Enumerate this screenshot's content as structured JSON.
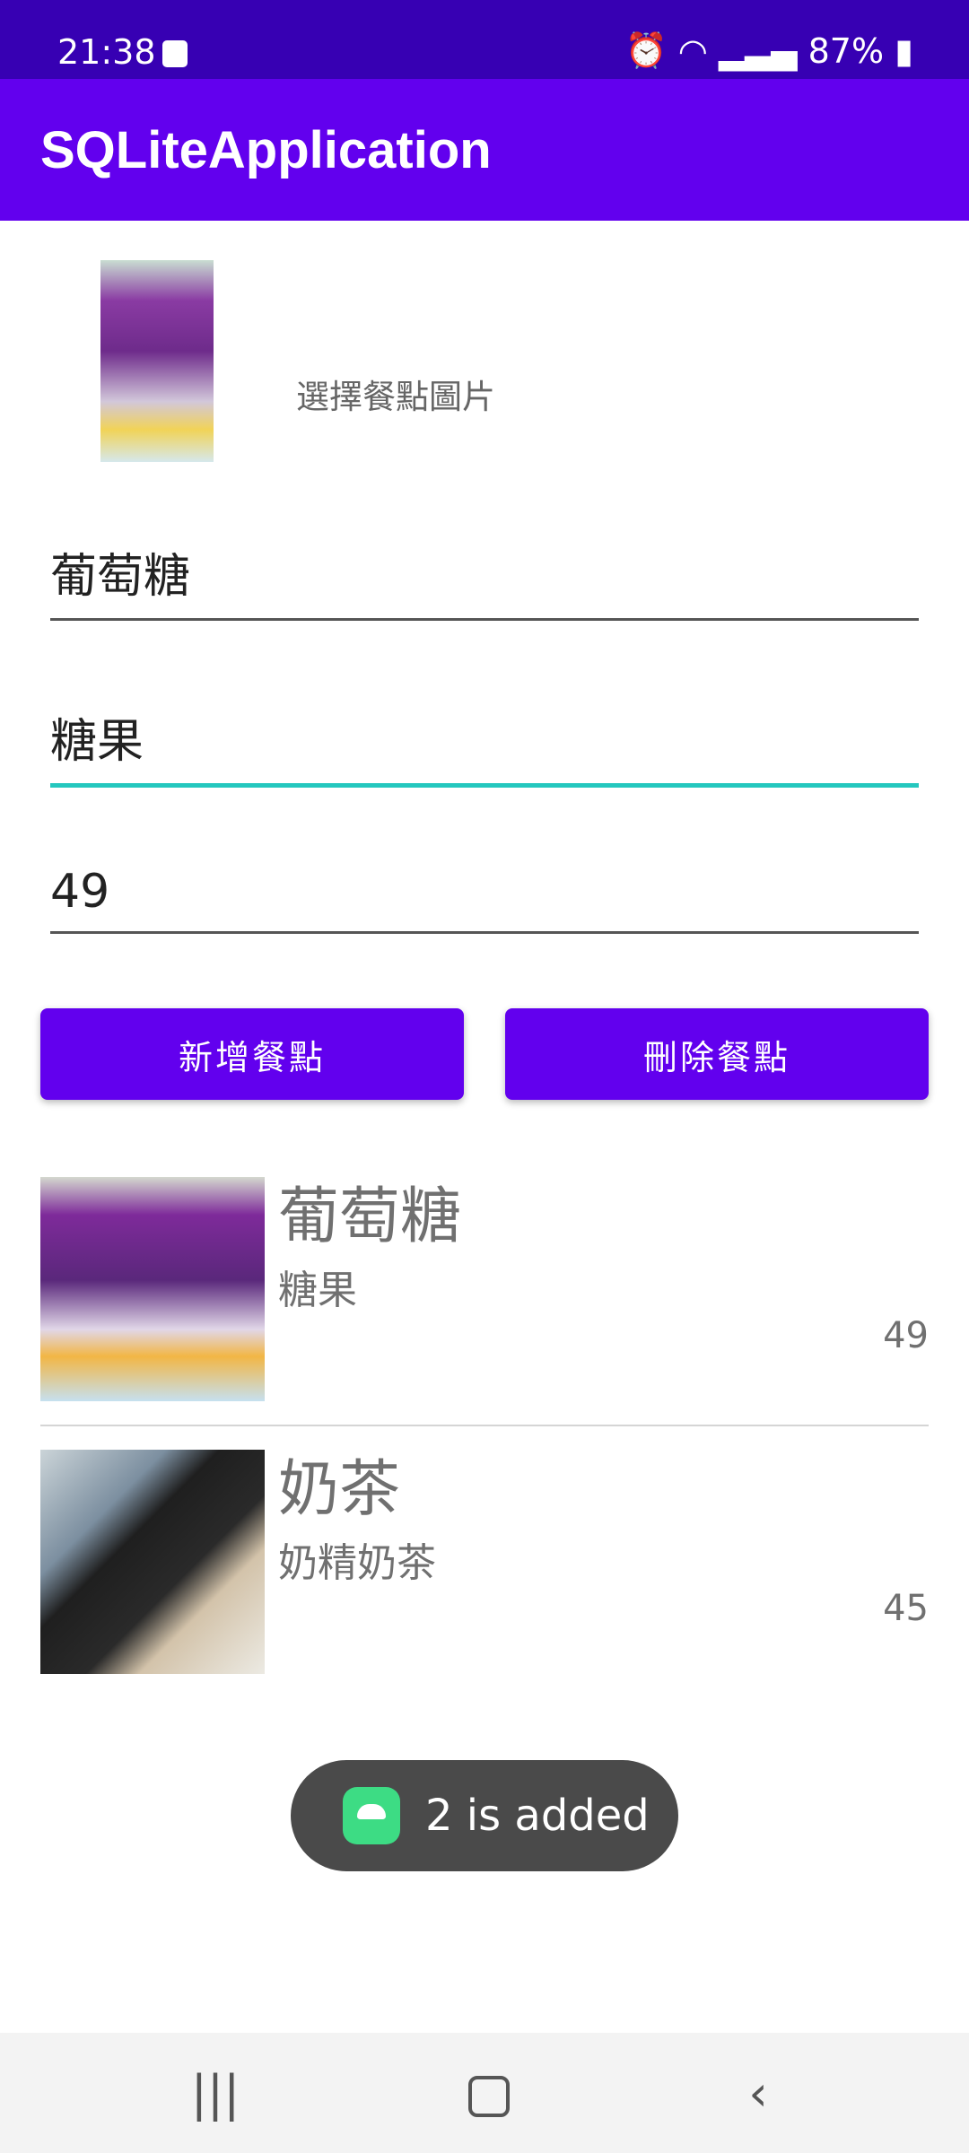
{
  "status_bar": {
    "time": "21:38",
    "icons": [
      "checkbox-icon",
      "alarm-icon",
      "wifi-icon",
      "signal-icon",
      "battery-icon"
    ],
    "battery": "87%"
  },
  "app_bar": {
    "title": "SQLiteApplication"
  },
  "image_picker": {
    "label": "選擇餐點圖片"
  },
  "fields": {
    "name": "葡萄糖",
    "description": "糖果",
    "price": "49"
  },
  "buttons": {
    "add": "新增餐點",
    "delete": "刪除餐點"
  },
  "items": [
    {
      "name": "葡萄糖",
      "description": "糖果",
      "price": "49"
    },
    {
      "name": "奶茶",
      "description": "奶精奶茶",
      "price": "45"
    }
  ],
  "toast": {
    "text": "2 is added"
  },
  "colors": {
    "status_bar": "#3700b3",
    "primary": "#6200ee",
    "focus_line": "#24c7be",
    "toast": "#4a4a4a"
  }
}
